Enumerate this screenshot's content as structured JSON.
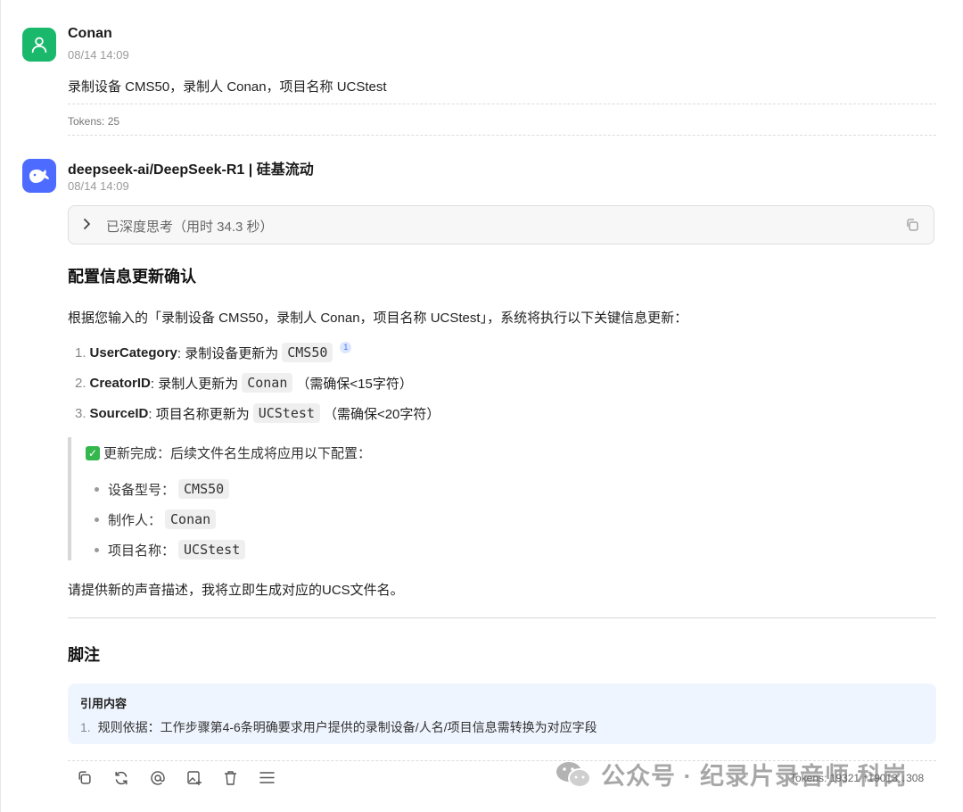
{
  "user_message": {
    "name": "Conan",
    "time": "08/14 14:09",
    "text": "录制设备 CMS50，录制人 Conan，项目名称 UCStest",
    "tokens": "Tokens: 25"
  },
  "assistant_message": {
    "name": "deepseek-ai/DeepSeek-R1 | 硅基流动",
    "time": "08/14 14:09",
    "thinking_label": "已深度思考（用时 34.3 秒）",
    "heading": "配置信息更新确认",
    "intro": "根据您输入的「录制设备 CMS50，录制人 Conan，项目名称 UCStest」，系统将执行以下关键信息更新：",
    "items": [
      {
        "num": "1.",
        "key": "UserCategory",
        "text": ": 录制设备更新为",
        "code": "CMS50",
        "note": "",
        "footnote": "1"
      },
      {
        "num": "2.",
        "key": "CreatorID",
        "text": ": 录制人更新为",
        "code": "Conan",
        "note": "（需确保<15字符）",
        "footnote": ""
      },
      {
        "num": "3.",
        "key": "SourceID",
        "text": ": 项目名称更新为",
        "code": "UCStest",
        "note": "（需确保<20字符）",
        "footnote": ""
      }
    ],
    "quote": {
      "status": "更新完成：后续文件名生成将应用以下配置：",
      "bullets": [
        {
          "label": "设备型号：",
          "code": "CMS50"
        },
        {
          "label": "制作人：",
          "code": "Conan"
        },
        {
          "label": "项目名称：",
          "code": "UCStest"
        }
      ]
    },
    "closing": "请提供新的声音描述，我将立即生成对应的UCS文件名。",
    "footnote_heading": "脚注",
    "citation": {
      "title": "引用内容",
      "items": [
        {
          "num": "1.",
          "text": "规则依据：工作步骤第4-6条明确要求用户提供的录制设备/人名/项目信息需转换为对应字段"
        }
      ]
    },
    "tokens": "Tokens: 19321 ↑19013 ↓308"
  },
  "watermark": "公众号 · 纪录片录音师 科岗",
  "icons": {
    "user_avatar": "user-icon",
    "bot_avatar": "whale-icon",
    "toolbar": [
      "copy-icon",
      "refresh-icon",
      "at-icon",
      "image-plus-icon",
      "trash-icon",
      "menu-icon"
    ]
  },
  "colors": {
    "user_avatar_bg": "#19b86a",
    "bot_avatar_bg": "#4d6bfe",
    "citation_bg": "#eff5ff"
  }
}
